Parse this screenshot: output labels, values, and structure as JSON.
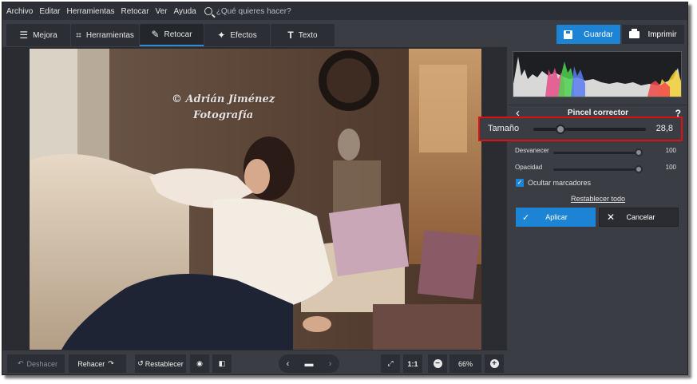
{
  "menu": {
    "items": [
      "Archivo",
      "Editar",
      "Herramientas",
      "Retocar",
      "Ver",
      "Ayuda"
    ],
    "search_placeholder": "¿Qué quieres hacer?"
  },
  "tabs": [
    {
      "label": "Mejora",
      "icon": "sliders-icon"
    },
    {
      "label": "Herramientas",
      "icon": "crop-icon"
    },
    {
      "label": "Retocar",
      "icon": "brush-icon",
      "active": true
    },
    {
      "label": "Efectos",
      "icon": "magic-wand-icon"
    },
    {
      "label": "Texto",
      "icon": "text-icon"
    }
  ],
  "toolbar": {
    "save_label": "Guardar",
    "print_label": "Imprimir"
  },
  "photo": {
    "watermark_line1": "© Adrián Jiménez",
    "watermark_line2": "Fotografía"
  },
  "panel": {
    "title": "Pincel corrector",
    "back_icon": "chevron-left-icon",
    "help_label": "?",
    "sliders": [
      {
        "label": "Tamaño",
        "value": "28,8",
        "fraction": 0.2
      },
      {
        "label": "Desvanecer",
        "value": "100",
        "fraction": 1.0
      },
      {
        "label": "Opacidad",
        "value": "100",
        "fraction": 1.0
      }
    ],
    "checkbox": {
      "label": "Ocultar marcadores",
      "checked": true
    },
    "reset_label": "Restablecer todo",
    "apply_label": "Aplicar",
    "cancel_label": "Cancelar"
  },
  "bottom": {
    "undo_label": "Deshacer",
    "redo_label": "Rehacer",
    "restore_label": "Restablecer",
    "ratio_label": "1:1",
    "zoom": "66%"
  },
  "colors": {
    "accent": "#1d83d5",
    "highlight": "#e01010",
    "panel_bg": "#3a3d44"
  }
}
